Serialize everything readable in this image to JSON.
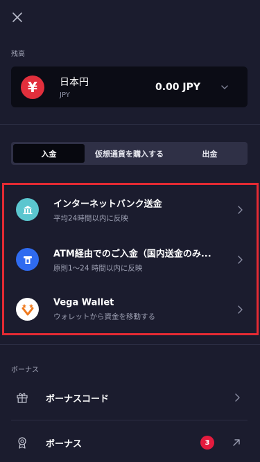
{
  "header": {
    "close_icon": "close-icon"
  },
  "balance": {
    "section_label": "残高",
    "currency_icon": "yen-icon",
    "currency_symbol": "¥",
    "currency_name": "日本円",
    "currency_code": "JPY",
    "amount": "0.00 JPY",
    "dropdown_icon": "chevron-down-icon"
  },
  "tabs": [
    {
      "label": "入金",
      "active": true
    },
    {
      "label": "仮想通貨を購入する",
      "active": false
    },
    {
      "label": "出金",
      "active": false
    }
  ],
  "methods": [
    {
      "title": "インターネットバンク送金",
      "subtitle": "平均24時間以内に反映",
      "icon": "bank-icon",
      "icon_color": "#5bc6cf"
    },
    {
      "title": "ATM経由でのご入金（国内送金のみ...",
      "subtitle": "原則1～24 時間以内に反映",
      "icon": "atm-icon",
      "icon_color": "#2f6bf0"
    },
    {
      "title": "Vega Wallet",
      "subtitle": "ウォレットから資金を移動する",
      "icon": "vega-wallet-icon",
      "icon_color": "#ffffff"
    }
  ],
  "bonus": {
    "section_label": "ボーナス",
    "code_label": "ボーナスコード",
    "code_icon": "gift-icon",
    "bonus_label": "ボーナス",
    "bonus_icon": "award-icon",
    "bonus_count": "3"
  },
  "colors": {
    "background": "#1b1c2e",
    "card": "#0b0c15",
    "highlight_border": "#e42a33",
    "badge": "#e41b3e"
  }
}
